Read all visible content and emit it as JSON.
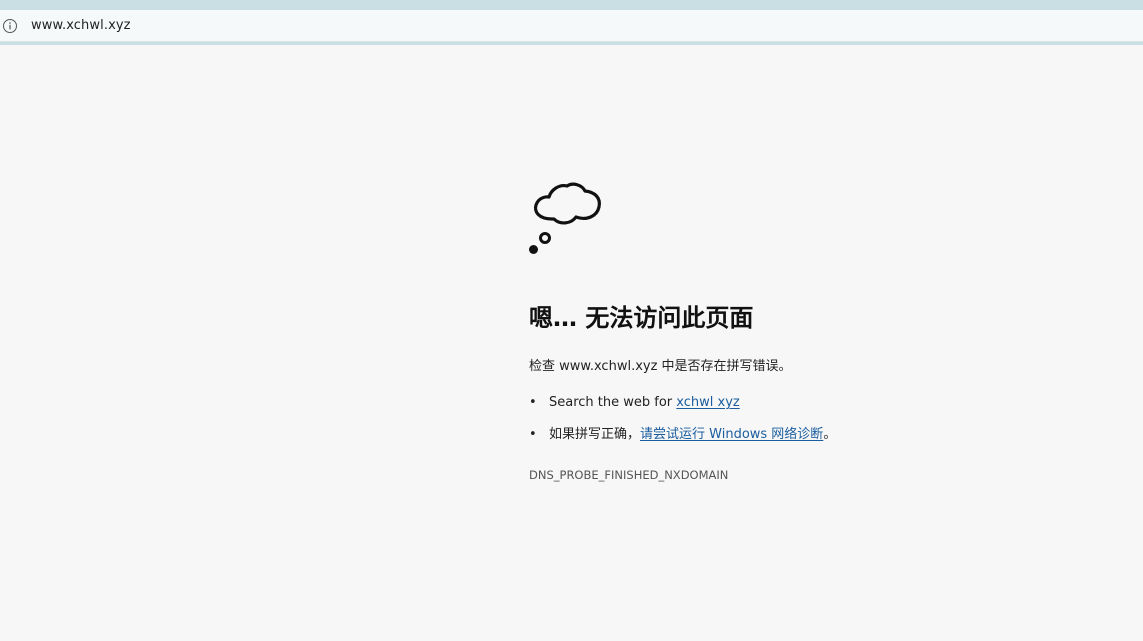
{
  "address_bar": {
    "url": "www.xchwl.xyz",
    "info_icon": "info-circle-icon"
  },
  "error_page": {
    "icon": "thought-cloud-icon",
    "title": "嗯… 无法访问此页面",
    "check_text": "检查 www.xchwl.xyz 中是否存在拼写错误。",
    "suggestions": [
      {
        "bullet": "•",
        "prefix": "Search the web for ",
        "link_text": "xchwl xyz",
        "suffix": ""
      },
      {
        "bullet": "•",
        "prefix": "如果拼写正确，",
        "link_text": "请尝试运行 Windows 网络诊断",
        "suffix": "。"
      }
    ],
    "error_code": "DNS_PROBE_FINISHED_NXDOMAIN"
  },
  "colors": {
    "background": "#f7f7f7",
    "address_bar": "#f5f9fa",
    "accent_strip": "#c9dfe3",
    "link": "#1a5d9e"
  }
}
